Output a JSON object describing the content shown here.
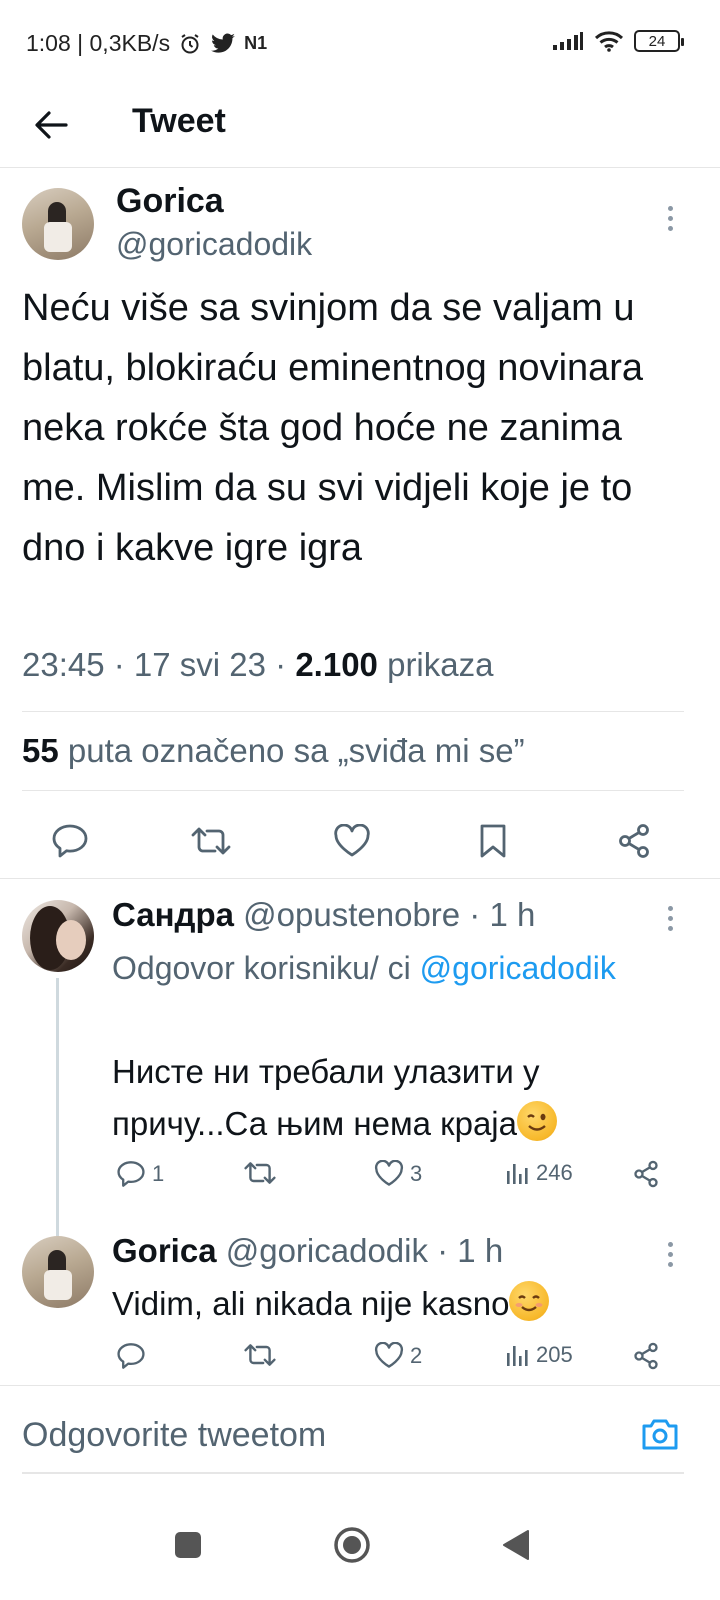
{
  "status_bar": {
    "time_speed": "1:08 | 0,3KB/s",
    "network_label": "N1",
    "battery": "24"
  },
  "header": {
    "title": "Tweet"
  },
  "main_tweet": {
    "name": "Gorica",
    "handle": "@goricadodik",
    "text": "Neću više sa svinjom da se valjam u blatu, blokiraću eminentnog novinara neka rokće šta god hoće ne zanima me. Mislim da su svi vidjeli koje je to dno i kakve igre igra",
    "time_date": "23:45 · 17 svi 23 · ",
    "views_count": "2.100",
    "views_label": " prikaza",
    "likes_count": "55",
    "likes_label": " puta označeno sa „sviđa mi se”"
  },
  "replies": [
    {
      "name": "Сандра",
      "handle": " @opustenobre · 1 h",
      "reply_to_prefix": "Odgovor korisniku/ ci ",
      "reply_to_mention": "@goricadodik",
      "text": "Нисте ни требали улазити у причу...Са њим нема краја",
      "emoji": "winking-face",
      "replies_count": "1",
      "retweets_count": "",
      "likes_count": "3",
      "views_count": "246"
    },
    {
      "name": "Gorica",
      "handle": " @goricadodik · 1 h",
      "text": "Vidim, ali nikada nije kasno",
      "emoji": "smiling-face",
      "replies_count": "",
      "retweets_count": "",
      "likes_count": "2",
      "views_count": "205"
    }
  ],
  "reply_box": {
    "placeholder": "Odgovorite tweetom"
  },
  "colors": {
    "accent": "#1d9bf0",
    "secondary_text": "#536471",
    "primary_text": "#0f1419"
  }
}
